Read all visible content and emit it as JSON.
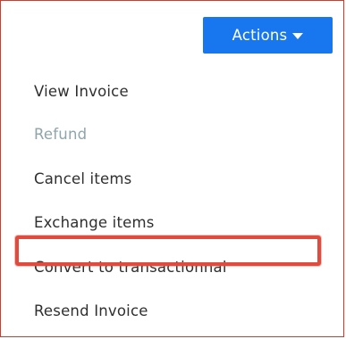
{
  "actions_button": {
    "label": "Actions",
    "icon": "caret-down-icon",
    "color": "#1877ee"
  },
  "menu": {
    "items": [
      {
        "label": "View Invoice",
        "enabled": true
      },
      {
        "label": "Refund",
        "enabled": false
      },
      {
        "label": "Cancel items",
        "enabled": true
      },
      {
        "label": "Exchange items",
        "enabled": true
      },
      {
        "label": "Convert to transactionnal",
        "enabled": true,
        "highlighted": true
      },
      {
        "label": "Resend Invoice",
        "enabled": true
      }
    ]
  },
  "highlight": {
    "color": "#e04b3d"
  }
}
